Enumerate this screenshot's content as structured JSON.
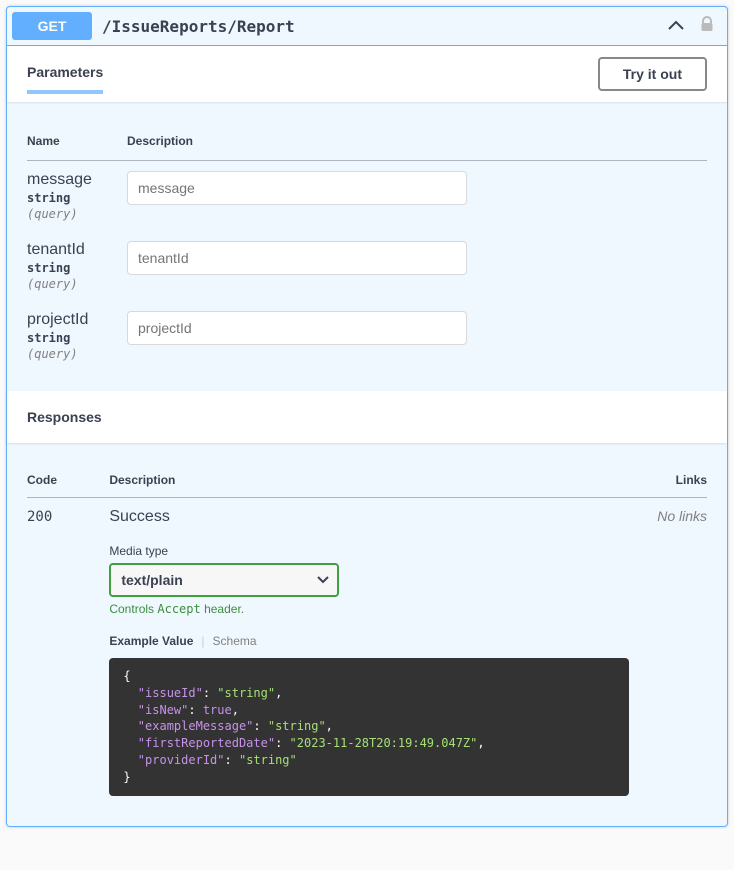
{
  "method": "GET",
  "path": "/IssueReports/Report",
  "tabs": {
    "parameters_label": "Parameters",
    "try_label": "Try it out"
  },
  "param_table": {
    "name_header": "Name",
    "desc_header": "Description"
  },
  "parameters": [
    {
      "name": "message",
      "type": "string",
      "in": "(query)",
      "placeholder": "message"
    },
    {
      "name": "tenantId",
      "type": "string",
      "in": "(query)",
      "placeholder": "tenantId"
    },
    {
      "name": "projectId",
      "type": "string",
      "in": "(query)",
      "placeholder": "projectId"
    }
  ],
  "responses_label": "Responses",
  "response_table": {
    "code_header": "Code",
    "desc_header": "Description",
    "links_header": "Links"
  },
  "response": {
    "code": "200",
    "description": "Success",
    "no_links": "No links",
    "media_type_label": "Media type",
    "media_type": "text/plain",
    "controls_text": "Controls ",
    "accept_text": "Accept",
    "header_text": " header.",
    "example_label": "Example Value",
    "schema_label": "Schema",
    "example": {
      "issueId": "string",
      "isNew": true,
      "exampleMessage": "string",
      "firstReportedDate": "2023-11-28T20:19:49.047Z",
      "providerId": "string"
    }
  }
}
